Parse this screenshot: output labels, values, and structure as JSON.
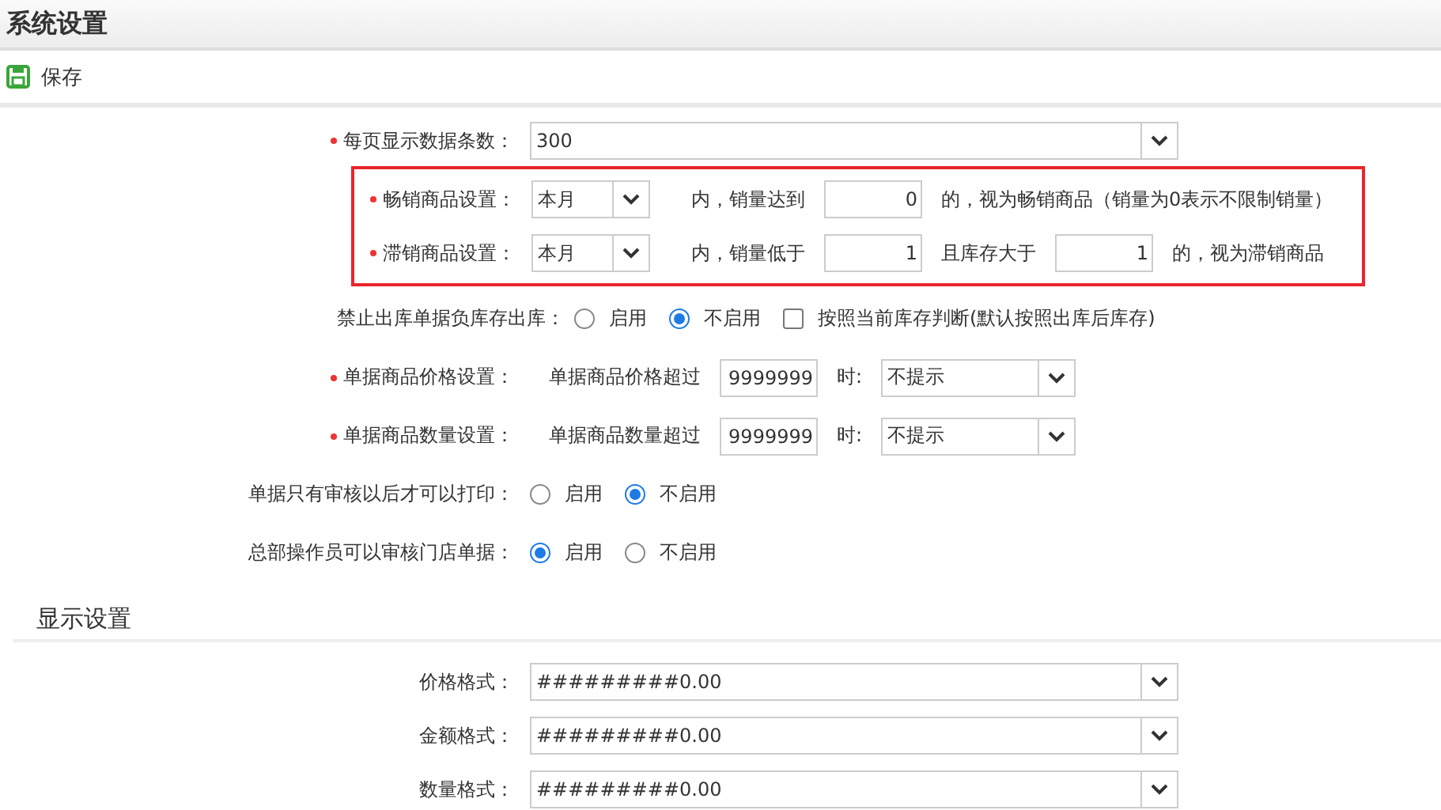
{
  "window": {
    "title": "系统设置"
  },
  "toolbar": [
    {
      "label": "保存"
    }
  ],
  "sections": [
    {
      "rows": [
        {
          "label": "每页显示数据条数：",
          "required": true,
          "parts": [
            {
              "kind": "select",
              "value": "300"
            }
          ]
        },
        {
          "highlighted": true,
          "rows": [
            {
              "label": "畅销商品设置：",
              "required": true,
              "parts": [
                {
                  "kind": "select",
                  "value": "本月"
                },
                {
                  "kind": "text",
                  "text": "内，销量达到"
                },
                {
                  "kind": "input",
                  "value": "0"
                },
                {
                  "kind": "text",
                  "text": "的，视为畅销商品（销量为0表示不限制销量）"
                }
              ]
            },
            {
              "label": "滞销商品设置：",
              "required": true,
              "parts": [
                {
                  "kind": "select",
                  "value": "本月"
                },
                {
                  "kind": "text",
                  "text": "内，销量低于"
                },
                {
                  "kind": "input",
                  "value": "1"
                },
                {
                  "kind": "text",
                  "text": "且库存大于"
                },
                {
                  "kind": "input",
                  "value": "1"
                },
                {
                  "kind": "text",
                  "text": "的，视为滞销商品"
                }
              ]
            }
          ]
        },
        {
          "label": "禁止出库单据负库存出库：",
          "required": false,
          "parts": [
            {
              "kind": "radio",
              "label": "启用",
              "selected": false
            },
            {
              "kind": "radio",
              "label": "不启用",
              "selected": true
            },
            {
              "kind": "checkbox",
              "label": "按照当前库存判断(默认按照出库后库存)",
              "checked": false
            }
          ]
        },
        {
          "label": "单据商品价格设置：",
          "required": true,
          "parts": [
            {
              "kind": "text",
              "text": "单据商品价格超过"
            },
            {
              "kind": "input",
              "value": "9999999"
            },
            {
              "kind": "text",
              "text": "时:"
            },
            {
              "kind": "select",
              "value": "不提示"
            }
          ]
        },
        {
          "label": "单据商品数量设置：",
          "required": true,
          "parts": [
            {
              "kind": "text",
              "text": "单据商品数量超过"
            },
            {
              "kind": "input",
              "value": "9999999"
            },
            {
              "kind": "text",
              "text": "时:"
            },
            {
              "kind": "select",
              "value": "不提示"
            }
          ]
        },
        {
          "label": "单据只有审核以后才可以打印：",
          "required": false,
          "parts": [
            {
              "kind": "radio",
              "label": "启用",
              "selected": false
            },
            {
              "kind": "radio",
              "label": "不启用",
              "selected": true
            }
          ]
        },
        {
          "label": "总部操作员可以审核门店单据：",
          "required": false,
          "parts": [
            {
              "kind": "radio",
              "label": "启用",
              "selected": true
            },
            {
              "kind": "radio",
              "label": "不启用",
              "selected": false
            }
          ]
        }
      ]
    },
    {
      "title": "显示设置",
      "rows": [
        {
          "label": "价格格式：",
          "required": false,
          "parts": [
            {
              "kind": "select",
              "value": "#########0.00"
            }
          ]
        },
        {
          "label": "金额格式：",
          "required": false,
          "parts": [
            {
              "kind": "select",
              "value": "#########0.00"
            }
          ]
        },
        {
          "label": "数量格式：",
          "required": false,
          "parts": [
            {
              "kind": "select",
              "value": "#########0.00"
            }
          ]
        }
      ]
    }
  ]
}
